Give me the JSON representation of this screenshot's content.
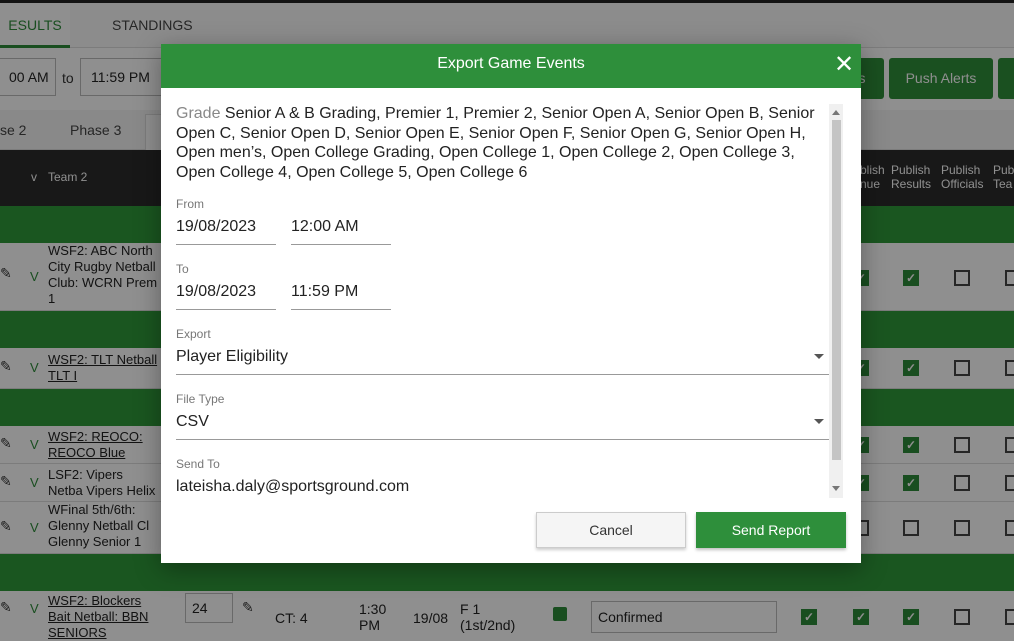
{
  "background": {
    "tabs": [
      {
        "label": "ESULTS",
        "active": true
      },
      {
        "label": "STANDINGS",
        "active": false
      }
    ],
    "time_from": "00 AM",
    "to_label": "to",
    "time_to": "11:59 PM",
    "buttons": [
      "s",
      "Push Alerts"
    ],
    "phases": [
      "se 2",
      "Phase 3"
    ],
    "table_header": {
      "v": "v",
      "team2": "Team 2",
      "publish_venue": "blish\nnue",
      "publish_results": "Publish\nResults",
      "publish_officials": "Publish\nOfficials",
      "publish_teams": "Pub\nTea"
    },
    "rows": [
      {
        "v": "V",
        "team2": "WSF2: ABC North City Rugby Netball Club: WCRN Prem 1",
        "link": false
      },
      {
        "v": "V",
        "team2": "WSF2: TLT Netball TLT I",
        "link": true
      },
      {
        "v": "V",
        "team2": "WSF2: REOCO: REOCO Blue",
        "link": true
      },
      {
        "v": "V",
        "team2": "LSF2: Vipers Netba Vipers Helix",
        "link": false
      },
      {
        "v": "V",
        "team2": "WFinal 5th/6th: Glenny  Netball Cl Glenny  Senior 1",
        "link": false
      },
      {
        "v": "V",
        "team2": "WSF2: Blockers Bait Netball: BBN SENIORS",
        "link": true
      }
    ],
    "last_row": {
      "number": "24",
      "court": "CT: 4",
      "time": "1:30\nPM",
      "date": "19/08",
      "round": "F 1\n(1st/2nd)",
      "status": "Confirmed"
    }
  },
  "modal": {
    "title": "Export Game Events",
    "grade_label": "Grade",
    "grade_value": "Senior A & B Grading, Premier 1, Premier 2, Senior Open A, Senior Open B, Senior Open C, Senior Open D, Senior Open E, Senior Open F, Senior Open G, Senior Open H, Open men’s, Open College Grading, Open College 1, Open College 2, Open College 3, Open College 4, Open College 5, Open College 6",
    "from_label": "From",
    "from_date": "19/08/2023",
    "from_time": "12:00 AM",
    "to_label": "To",
    "to_date": "19/08/2023",
    "to_time": "11:59 PM",
    "export_label": "Export",
    "export_value": "Player Eligibility",
    "filetype_label": "File Type",
    "filetype_value": "CSV",
    "sendto_label": "Send To",
    "sendto_value": "lateisha.daly@sportsground.com",
    "cancel_label": "Cancel",
    "send_label": "Send Report"
  }
}
